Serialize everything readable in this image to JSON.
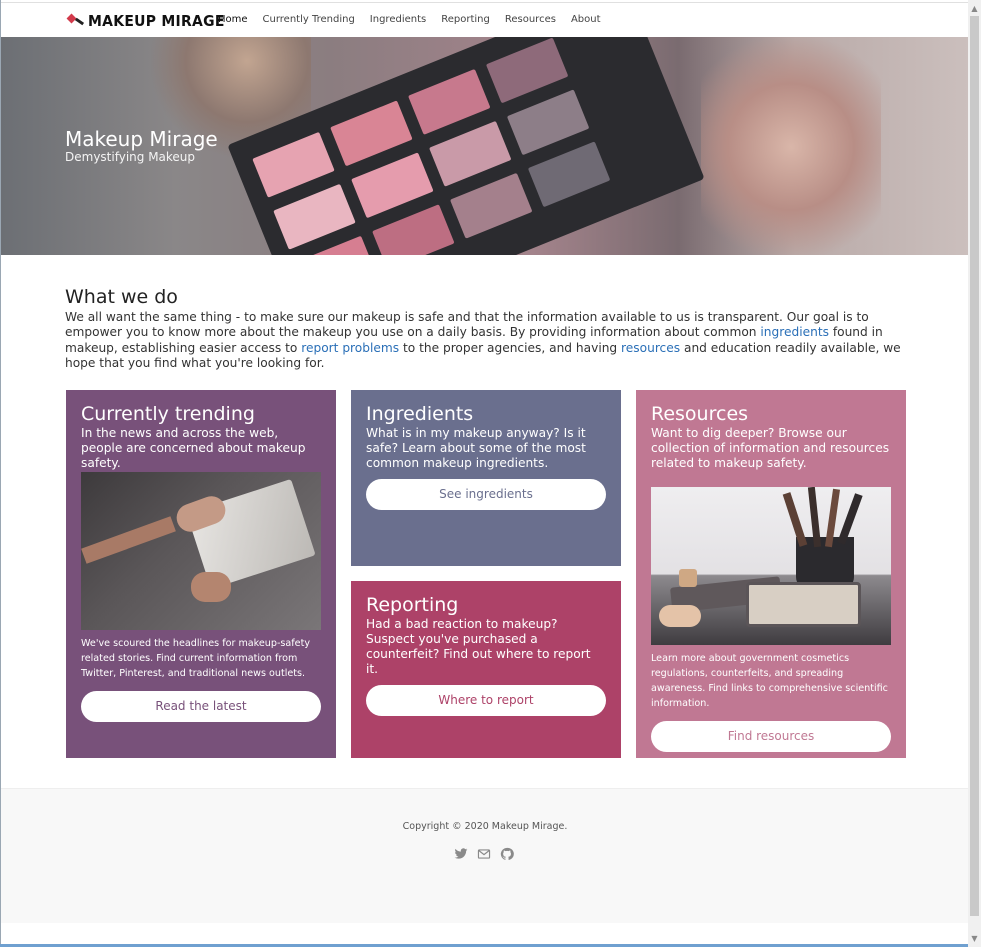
{
  "nav": {
    "brand": "MAKEUP MIRAGE",
    "links": [
      "Home",
      "Currently Trending",
      "Ingredients",
      "Reporting",
      "Resources",
      "About"
    ]
  },
  "hero": {
    "title": "Makeup Mirage",
    "subtitle": "Demystifying Makeup"
  },
  "about": {
    "heading": "What we do",
    "text_1": "We all want the same thing - to make sure our makeup is safe and that the information available to us is transparent. Our goal is to empower you to know more about the makeup you use on a daily basis. By providing information about common ",
    "link_1": "ingredients",
    "text_2": " found in makeup, establishing easier access to ",
    "link_2": "report problems",
    "text_3": " to the proper agencies, and having ",
    "link_3": "resources",
    "text_4": " and education readily available, we hope that you find what you're looking for."
  },
  "cards": {
    "trending": {
      "title": "Currently trending",
      "lead": "In the news and across the web, people are concerned about makeup safety.",
      "body": "We've scoured the headlines for makeup-safety related stories. Find current information from Twitter, Pinterest, and traditional news outlets.",
      "button": "Read the latest",
      "color": "#78517a"
    },
    "ingredients": {
      "title": "Ingredients",
      "lead": "What is in my makeup anyway? Is it safe? Learn about some of the most common makeup ingredients.",
      "button": "See ingredients",
      "color": "#6a6f8e"
    },
    "reporting": {
      "title": "Reporting",
      "lead": "Had a bad reaction to makeup? Suspect you've purchased a counterfeit? Find out where to report it.",
      "button": "Where to report",
      "color": "#ad4268"
    },
    "resources": {
      "title": "Resources",
      "lead": "Want to dig deeper? Browse our collection of information and resources related to makeup safety.",
      "body": "Learn more about government cosmetics regulations, counterfeits, and spreading awareness. Find links to comprehensive scientific information.",
      "button": "Find resources",
      "color": "#c07893"
    }
  },
  "footer": {
    "copyright": "Copyright © 2020 Makeup Mirage.",
    "icons": [
      "twitter-icon",
      "mail-icon",
      "github-icon"
    ]
  }
}
